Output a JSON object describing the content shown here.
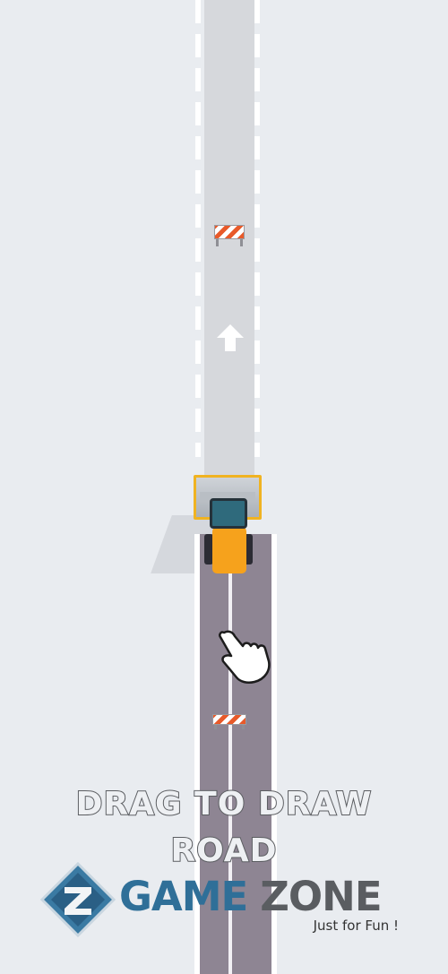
{
  "game": {
    "instruction_line1": "DRAG TO DRAW",
    "instruction_line2": "ROAD"
  },
  "watermark": {
    "brand_word1": "GAME",
    "brand_word2": "ZONE",
    "tagline": "Just for Fun !"
  },
  "icons": {
    "arrow": "up-arrow-icon",
    "hand": "pointing-hand-icon",
    "logo": "z-logo-icon"
  },
  "colors": {
    "background": "#e9ecf0",
    "unpaved_road": "#d6d8dc",
    "paved_road": "#8e8593",
    "machine_yellow": "#f6a21c",
    "barrier_orange": "#e85a2a",
    "logo_blue": "#2f6f98"
  }
}
